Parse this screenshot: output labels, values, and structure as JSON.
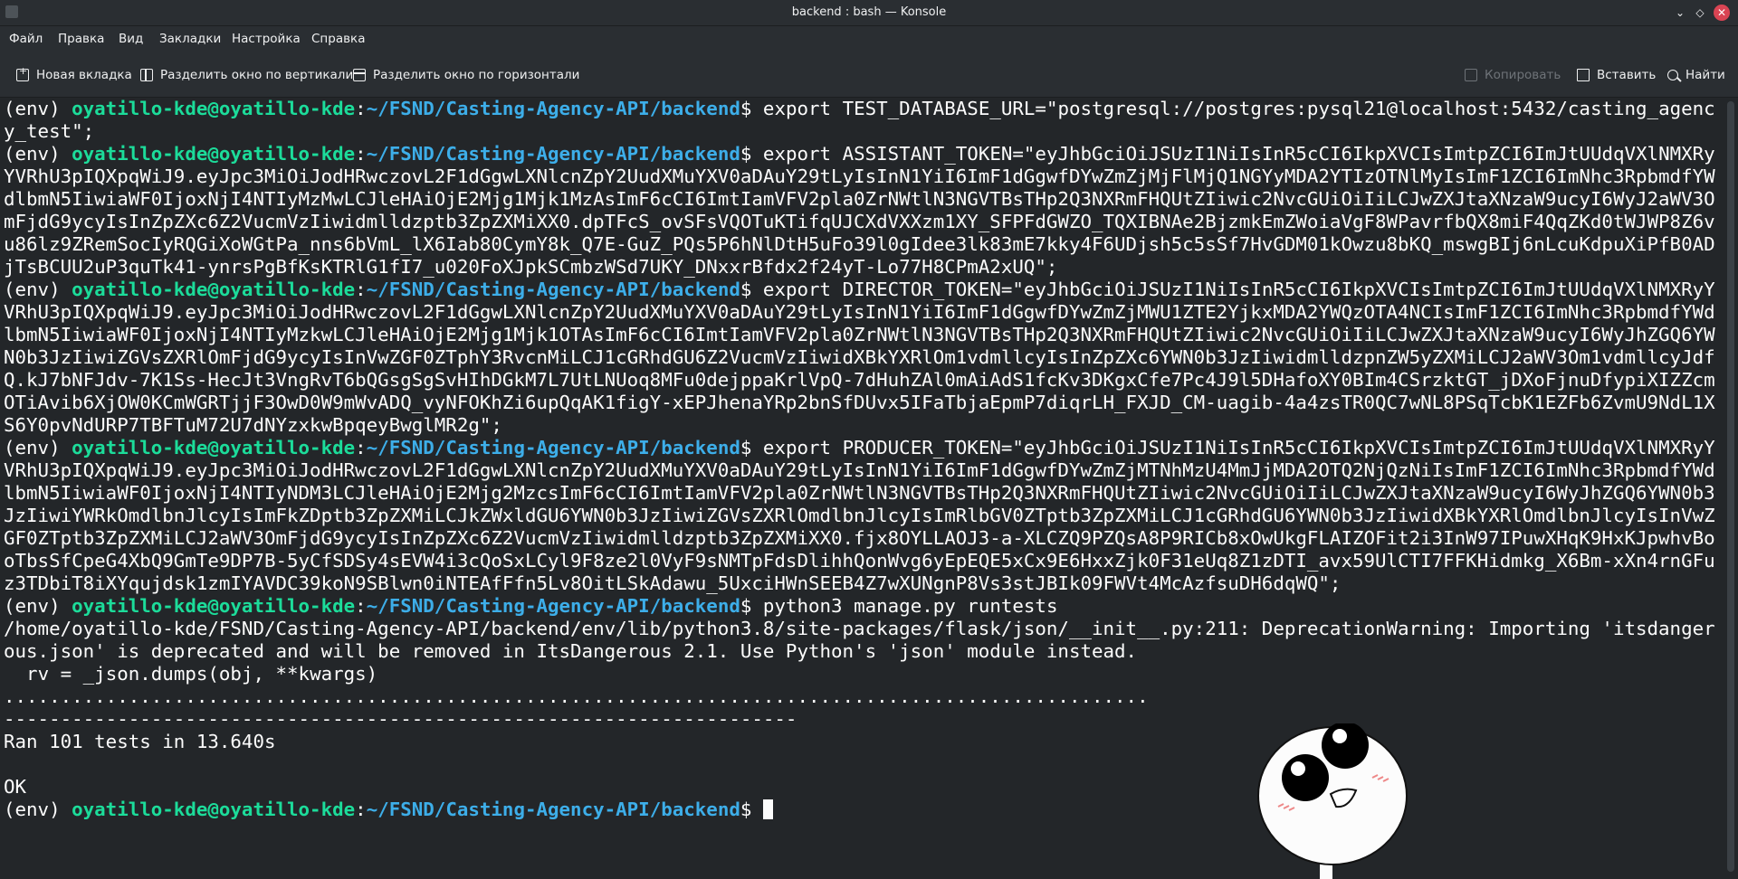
{
  "window": {
    "title": "backend : bash — Konsole",
    "buttons": {
      "minimize": "⌄",
      "maximize": "◇",
      "close": "✕"
    }
  },
  "menu": [
    "Файл",
    "Правка",
    "Вид",
    "Закладки",
    "Настройка",
    "Справка"
  ],
  "toolbar": {
    "new_tab": "Новая вкладка",
    "split_vertical": "Разделить окно по вертикали",
    "split_horizontal": "Разделить окно по горизонтали",
    "copy": "Копировать",
    "paste": "Вставить",
    "find": "Найти"
  },
  "prompt": {
    "env": "(env) ",
    "user": "oyatillo-kde@oyatillo-kde",
    "sep": ":",
    "path": "~/FSND/Casting-Agency-API/backend",
    "sign": "$ "
  },
  "terminal": {
    "cmd1": "export TEST_DATABASE_URL=\"postgresql://postgres:pysql21@localhost:5432/casting_agency_test\";",
    "cmd2": "export ASSISTANT_TOKEN=\"eyJhbGciOiJSUzI1NiIsInR5cCI6IkpXVCIsImtpZCI6ImJtUUdqVXlNMXRyYVRhU3pIQXpqWiJ9.eyJpc3MiOiJodHRwczovL2F1dGgwLXNlcnZpY2UudXMuYXV0aDAuY29tLyIsInN1YiI6ImF1dGgwfDYwZmZjMjFlMjQ1NGYyMDA2YTIzOTNlMyIsImF1ZCI6ImNhc3RpbmdfYWdlbmN5IiwiaWF0IjoxNjI4NTIyMzMwLCJleHAiOjE2Mjg1Mjk1MzAsImF6cCI6ImtIamVFV2pla0ZrNWtlN3NGVTBsTHp2Q3NXRmFHQUtZIiwic2NvcGUiOiIiLCJwZXJtaXNzaW9ucyI6WyJ2aWV3OmFjdG9ycyIsInZpZXc6Z2VucmVzIiwidmlldzptb3ZpZXMiXX0.dpTFcS_ovSFsVQOTuKTifqUJCXdVXXzm1XY_SFPFdGWZO_TQXIBNAe2BjzmkEmZWoiaVgF8WPavrfbQX8miF4QqZKd0tWJWP8Z6vu86lz9ZRemSocIyRQGiXoWGtPa_nns6bVmL_lX6Iab80CymY8k_Q7E-GuZ_PQs5P6hNlDtH5uFo39l0gIdee3lk83mE7kky4F6UDjsh5c5sSf7HvGDM01kOwzu8bKQ_mswgBIj6nLcuKdpuXiPfB0ADjTsBCUU2uP3quTk41-ynrsPgBfKsKTRlG1fI7_u020FoXJpkSCmbzWSd7UKY_DNxxrBfdx2f24yT-Lo77H8CPmA2xUQ\";",
    "cmd3": "export DIRECTOR_TOKEN=\"eyJhbGciOiJSUzI1NiIsInR5cCI6IkpXVCIsImtpZCI6ImJtUUdqVXlNMXRyYVRhU3pIQXpqWiJ9.eyJpc3MiOiJodHRwczovL2F1dGgwLXNlcnZpY2UudXMuYXV0aDAuY29tLyIsInN1YiI6ImF1dGgwfDYwZmZjMWU1ZTE2YjkxMDA2YWQzOTA4NCIsImF1ZCI6ImNhc3RpbmdfYWdlbmN5IiwiaWF0IjoxNjI4NTIyMzkwLCJleHAiOjE2Mjg1Mjk1OTAsImF6cCI6ImtIamVFV2pla0ZrNWtlN3NGVTBsTHp2Q3NXRmFHQUtZIiwic2NvcGUiOiIiLCJwZXJtaXNzaW9ucyI6WyJhZGQ6YWN0b3JzIiwiZGVsZXRlOmFjdG9ycyIsInVwZGF0ZTphY3RvcnMiLCJ1cGRhdGU6Z2VucmVzIiwidXBkYXRlOm1vdmllcyIsInZpZXc6YWN0b3JzIiwidmlldzpnZW5yZXMiLCJ2aWV3Om1vdmllcyJdfQ.kJ7bNFJdv-7K1Ss-HecJt3VngRvT6bQGsgSgSvHIhDGkM7L7UtLNUoq8MFu0dejppaKrlVpQ-7dHuhZAl0mAiAdS1fcKv3DKgxCfe7Pc4J9l5DHafoXY0BIm4CSrzktGT_jDXoFjnuDfypiXIZZcmOTiAvib6XjOW0KCmWGRTjjF3OwD0W9mWvADQ_vyNFOKhZi6upQqAK1figY-xEPJhenaYRp2bnSfDUvx5IFaTbjaEpmP7diqrLH_FXJD_CM-uagib-4a4zsTR0QC7wNL8PSqTcbK1EZFb6ZvmU9NdL1XS6Y0pvNdURP7TBFTuM72U7dNYzxkwBpqeyBwglMR2g\";",
    "cmd4": "export PRODUCER_TOKEN=\"eyJhbGciOiJSUzI1NiIsInR5cCI6IkpXVCIsImtpZCI6ImJtUUdqVXlNMXRyYVRhU3pIQXpqWiJ9.eyJpc3MiOiJodHRwczovL2F1dGgwLXNlcnZpY2UudXMuYXV0aDAuY29tLyIsInN1YiI6ImF1dGgwfDYwZmZjMTNhMzU4MmJjMDA2OTQ2NjQzNiIsImF1ZCI6ImNhc3RpbmdfYWdlbmN5IiwiaWF0IjoxNjI4NTIyNDM3LCJleHAiOjE2Mjg2MzcsImF6cCI6ImtIamVFV2pla0ZrNWtlN3NGVTBsTHp2Q3NXRmFHQUtZIiwic2NvcGUiOiIiLCJwZXJtaXNzaW9ucyI6WyJhZGQ6YWN0b3JzIiwiYWRkOmdlbnJlcyIsImFkZDptb3ZpZXMiLCJkZWxldGU6YWN0b3JzIiwiZGVsZXRlOmdlbnJlcyIsImRlbGV0ZTptb3ZpZXMiLCJ1cGRhdGU6YWN0b3JzIiwidXBkYXRlOmdlbnJlcyIsInVwZGF0ZTptb3ZpZXMiLCJ2aWV3OmFjdG9ycyIsInZpZXc6Z2VucmVzIiwidmlldzptb3ZpZXMiXX0.fjx8OYLLAOJ3-a-XLCZQ9PZQsA8P9RICb8xOwUkgFLAIZOFit2i3InW97IPuwXHqK9HxKJpwhvBooTbsSfCpeG4XbQ9GmTe9DP7B-5yCfSDSy4sEVW4i3cQoSxLCyl9F8ze2l0VyF9sNMTpFdsDlihhQonWvg6yEpEQE5xCx9E6HxxZjk0F31eUq8Z1zDTI_avx59UlCTI7FFKHidmkg_X6Bm-xXn4rnGFuz3TDbiT8iXYqujdsk1zmIYAVDC39koN9SBlwn0iNTEAfFfn5Lv8OitLSkAdawu_5UxciHWnSEEB4Z7wXUNgnP8Vs3stJBIk09FWVt4McAzfsuDH6dqWQ\";",
    "cmd5": "python3 manage.py runtests",
    "warning": "/home/oyatillo-kde/FSND/Casting-Agency-API/backend/env/lib/python3.8/site-packages/flask/json/__init__.py:211: DeprecationWarning: Importing 'itsdangerous.json' is deprecated and will be removed in ItsDangerous 2.1. Use Python's 'json' module instead.",
    "warning_code": "  rv = _json.dumps(obj, **kwargs)",
    "dots": ".....................................................................................................",
    "dashes": "----------------------------------------------------------------------",
    "ran": "Ran 101 tests in 13.640s",
    "blank": "",
    "ok": "OK"
  },
  "colors": {
    "background": "#232629",
    "text": "#fcfcfc",
    "prompt_user": "#1cdc9a",
    "prompt_path": "#3daee9",
    "close_button": "#da4453"
  },
  "icons": [
    "app-icon",
    "new-tab-icon",
    "split-vertical-icon",
    "split-horizontal-icon",
    "copy-icon",
    "paste-icon",
    "search-icon",
    "meme-face"
  ]
}
